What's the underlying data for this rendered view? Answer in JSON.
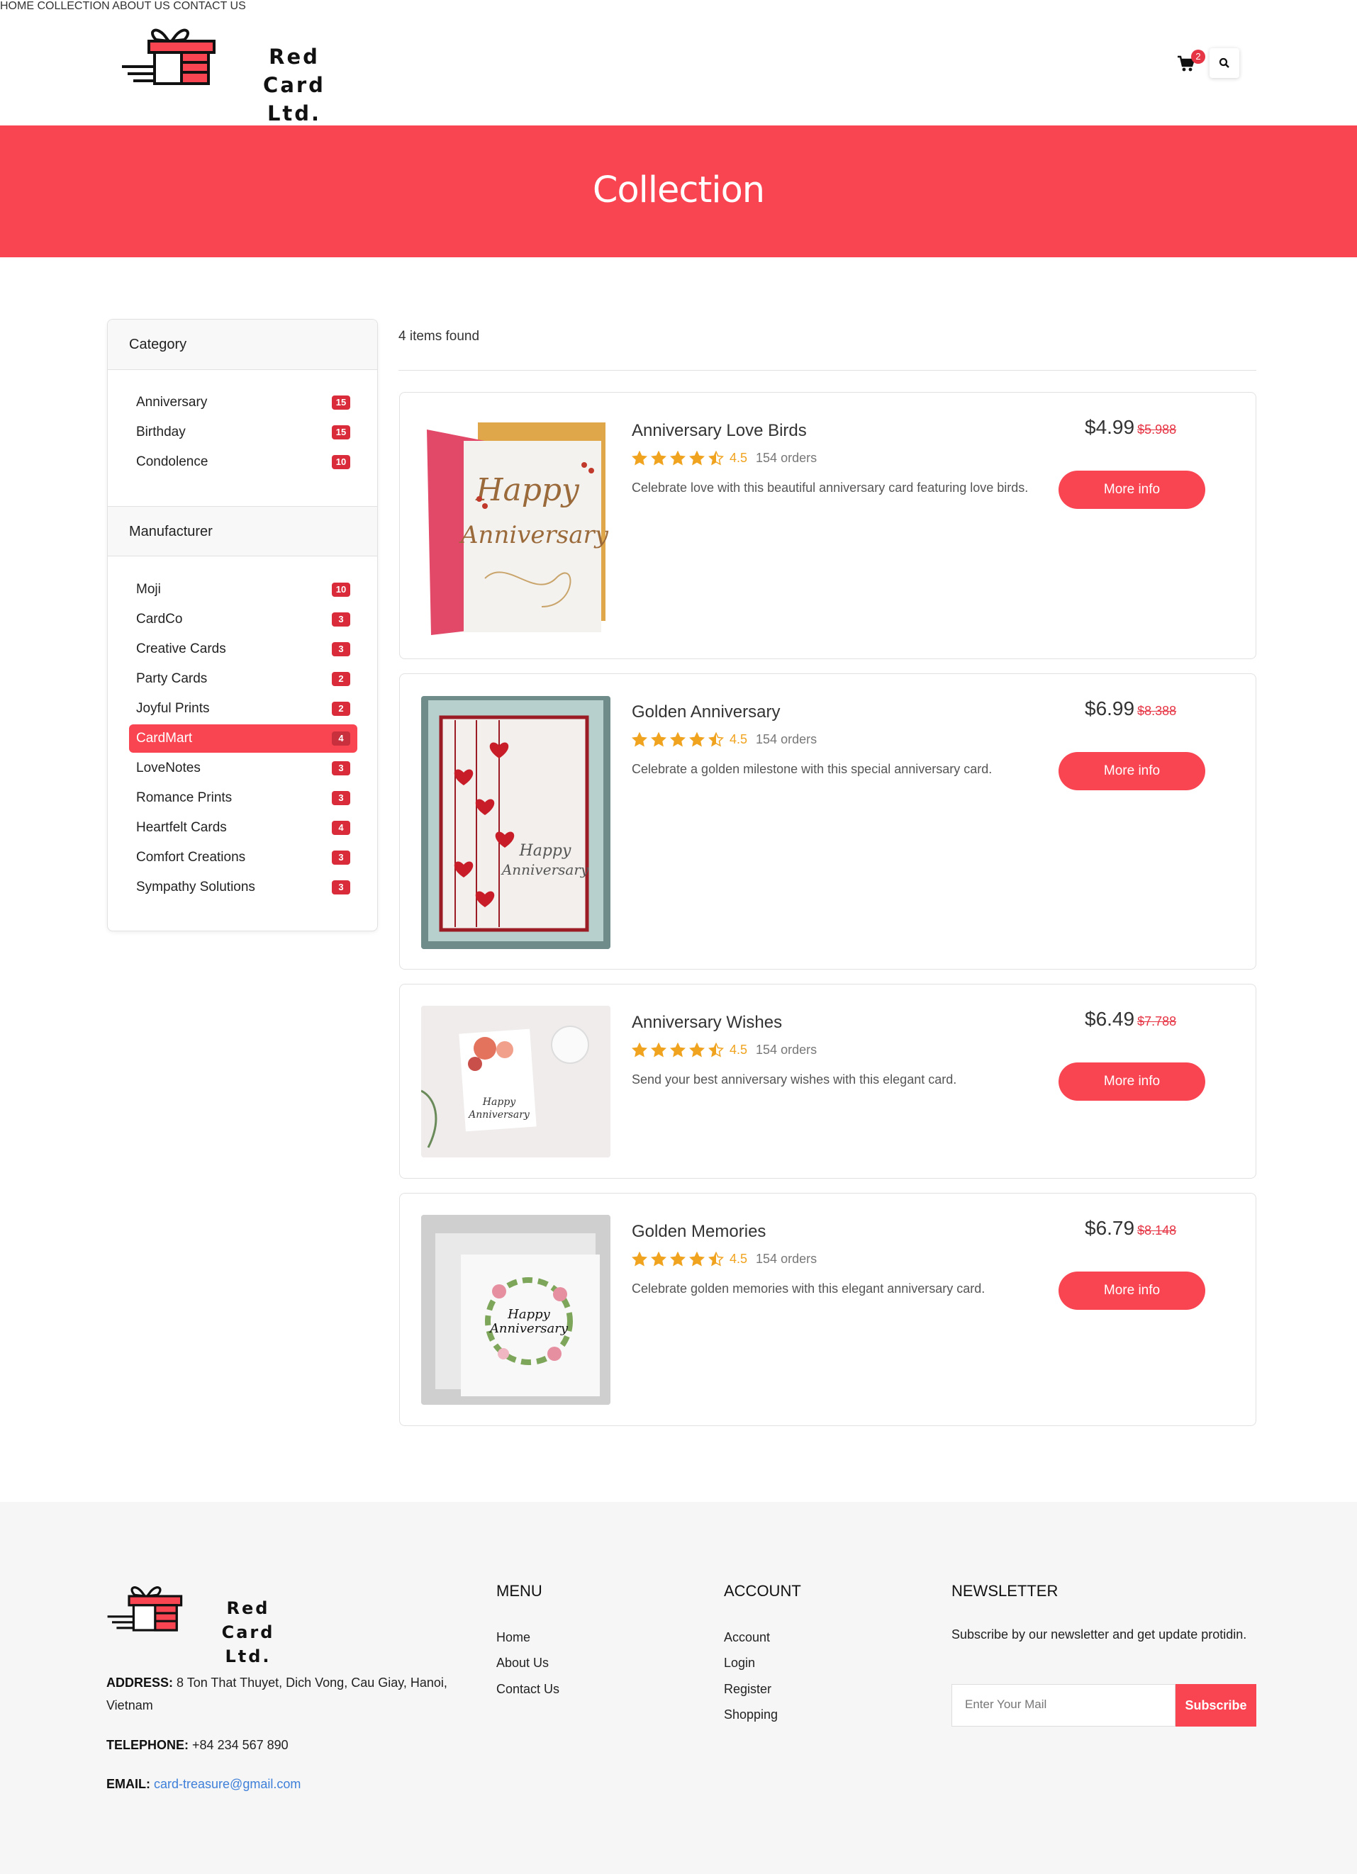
{
  "brand": {
    "name_line1": "Red Card",
    "name_line2": "Ltd."
  },
  "nav": {
    "items": [
      "HOME",
      "COLLECTION",
      "ABOUT US",
      "CONTACT US"
    ],
    "cart_count": "2"
  },
  "banner": {
    "title": "Collection"
  },
  "sidebar": {
    "category_title": "Category",
    "categories": [
      {
        "label": "Anniversary",
        "count": "15"
      },
      {
        "label": "Birthday",
        "count": "15"
      },
      {
        "label": "Condolence",
        "count": "10"
      }
    ],
    "manufacturer_title": "Manufacturer",
    "manufacturers": [
      {
        "label": "Moji",
        "count": "10"
      },
      {
        "label": "CardCo",
        "count": "3"
      },
      {
        "label": "Creative Cards",
        "count": "3"
      },
      {
        "label": "Party Cards",
        "count": "2"
      },
      {
        "label": "Joyful Prints",
        "count": "2"
      },
      {
        "label": "CardMart",
        "count": "4"
      },
      {
        "label": "LoveNotes",
        "count": "3"
      },
      {
        "label": "Romance Prints",
        "count": "3"
      },
      {
        "label": "Heartfelt Cards",
        "count": "4"
      },
      {
        "label": "Comfort Creations",
        "count": "3"
      },
      {
        "label": "Sympathy Solutions",
        "count": "3"
      }
    ],
    "active_manufacturer": "CardMart"
  },
  "results": {
    "count_text": "4 items found"
  },
  "products": [
    {
      "title": "Anniversary Love Birds",
      "rating": "4.5",
      "rating_value": 4.5,
      "orders": "154 orders",
      "description": "Celebrate love with this beautiful anniversary card featuring love birds.",
      "price": "$4.99",
      "old_price": "$5.988",
      "button": "More info"
    },
    {
      "title": "Golden Anniversary",
      "rating": "4.5",
      "rating_value": 4.5,
      "orders": "154 orders",
      "description": "Celebrate a golden milestone with this special anniversary card.",
      "price": "$6.99",
      "old_price": "$8.388",
      "button": "More info"
    },
    {
      "title": "Anniversary Wishes",
      "rating": "4.5",
      "rating_value": 4.5,
      "orders": "154 orders",
      "description": "Send your best anniversary wishes with this elegant card.",
      "price": "$6.49",
      "old_price": "$7.788",
      "button": "More info"
    },
    {
      "title": "Golden Memories",
      "rating": "4.5",
      "rating_value": 4.5,
      "orders": "154 orders",
      "description": "Celebrate golden memories with this elegant anniversary card.",
      "price": "$6.79",
      "old_price": "$8.148",
      "button": "More info"
    }
  ],
  "footer": {
    "address_label": "ADDRESS:",
    "address": "8 Ton That Thuyet, Dich Vong, Cau Giay, Hanoi, Vietnam",
    "telephone_label": "TELEPHONE:",
    "telephone": "+84 234 567 890",
    "email_label": "EMAIL:",
    "email": "card-treasure@gmail.com",
    "menu_title": "MENU",
    "menu_links": [
      "Home",
      "About Us",
      "Contact Us"
    ],
    "account_title": "ACCOUNT",
    "account_links": [
      "Account",
      "Login",
      "Register",
      "Shopping"
    ],
    "newsletter_title": "NEWSLETTER",
    "newsletter_text": "Subscribe by our newsletter and get update protidin.",
    "newsletter_placeholder": "Enter Your Mail",
    "newsletter_button": "Subscribe"
  },
  "colors": {
    "accent": "#f94552",
    "badge": "#d92b3a",
    "star": "#f0a31f",
    "link": "#3e7fd9"
  },
  "icons": [
    "cart-icon",
    "search-icon",
    "star-icon",
    "gift-logo-icon"
  ]
}
